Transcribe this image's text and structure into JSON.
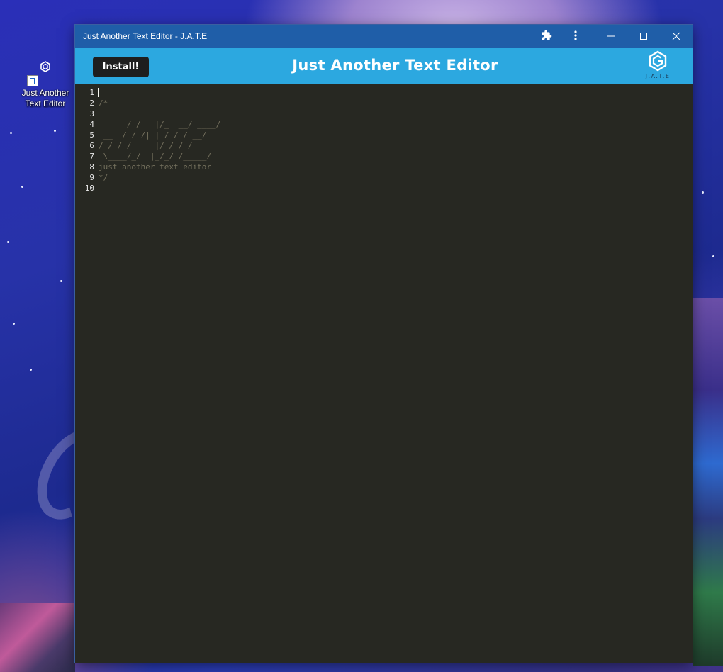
{
  "desktop": {
    "shortcut_label_line1": "Just Another",
    "shortcut_label_line2": "Text Editor"
  },
  "window": {
    "title": "Just Another Text Editor - J.A.T.E",
    "icons": [
      "extensions-icon",
      "more-vert-icon",
      "minimize-icon",
      "maximize-icon",
      "close-icon"
    ]
  },
  "header": {
    "install_label": "Install!",
    "app_title": "Just Another Text Editor",
    "logo_text": "J.A.T.E"
  },
  "editor": {
    "line_numbers": [
      "1",
      "2",
      "3",
      "4",
      "5",
      "6",
      "7",
      "8",
      "9",
      "10"
    ],
    "lines": [
      "",
      "/*",
      "       _____  ____________",
      "      / /   |/_  __/ ____/",
      " __  / / /| | / / / __/",
      "/ /_/ / ___ |/ / / /___",
      " \\____/_/  |_/_/ /_____/",
      "just another text editor",
      "*/",
      ""
    ]
  },
  "colors": {
    "titlebar": "#1f5ea8",
    "header": "#2ca8e0",
    "editor_bg": "#272822",
    "comment": "#75715e",
    "install_bg": "#1e1e1e"
  }
}
